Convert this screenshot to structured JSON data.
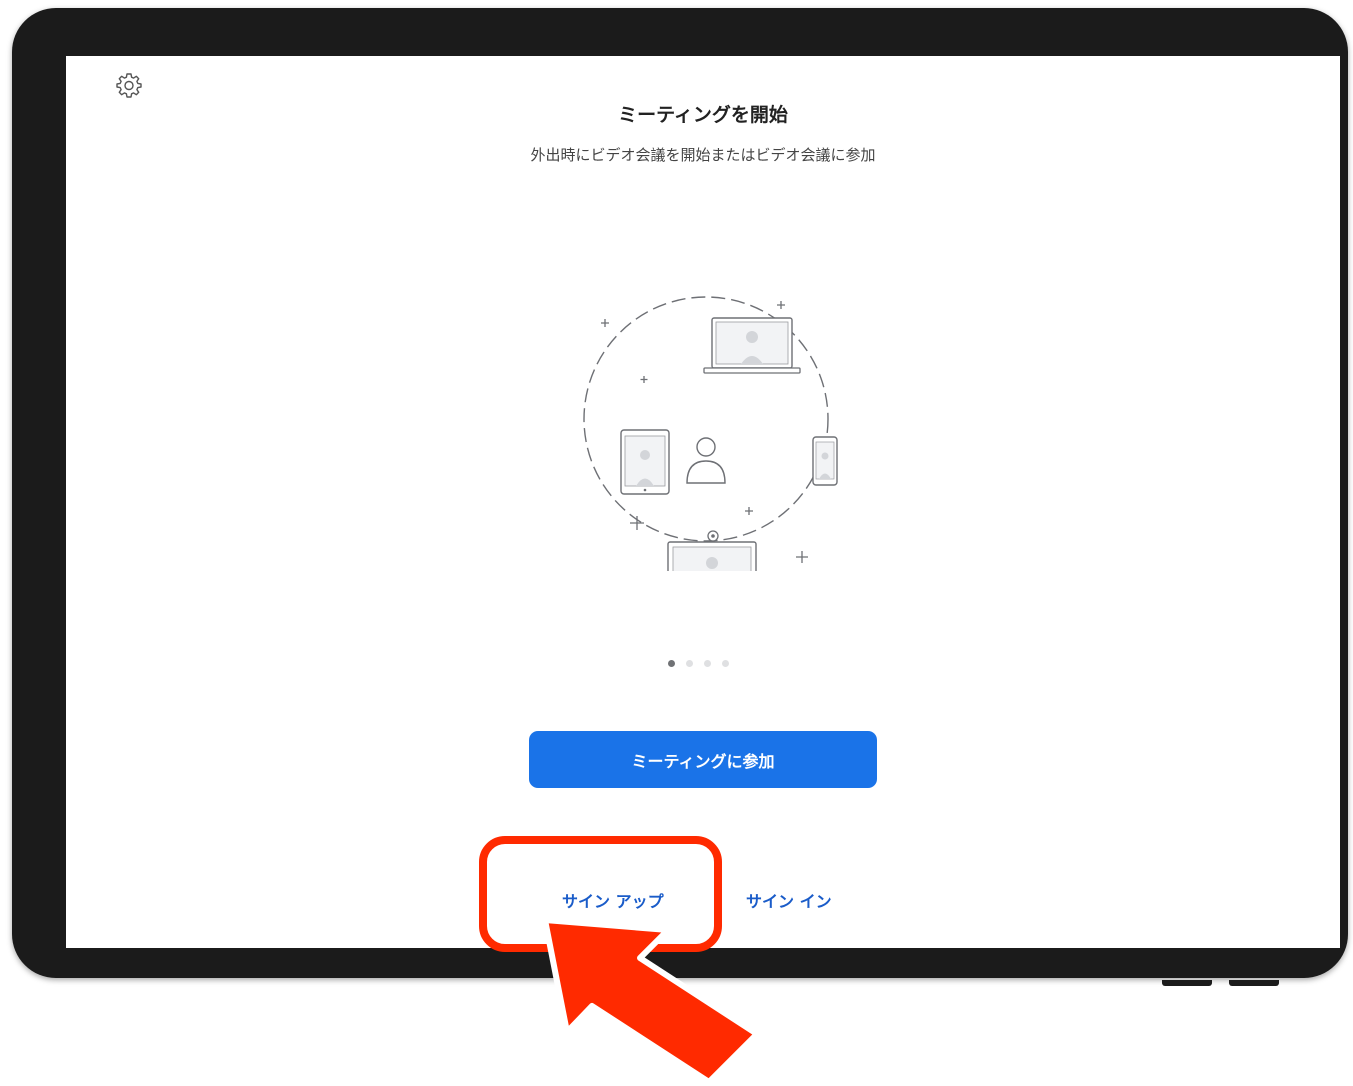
{
  "screen": {
    "title": "ミーティングを開始",
    "subtitle": "外出時にビデオ会議を開始またはビデオ会議に参加",
    "pager": {
      "count": 4,
      "active": 1
    },
    "join_button_label": "ミーティングに参加",
    "signup_label": "サイン アップ",
    "signin_label": "サイン イン"
  },
  "icons": {
    "settings": "gear-icon",
    "illustration": "video-meeting-devices-illustration",
    "callout_arrow": "red-arrow-icon"
  },
  "colors": {
    "accent": "#1a73e8",
    "link": "#1a5cc9",
    "callout": "#ff2a00",
    "device_frame": "#1b1b1b"
  }
}
